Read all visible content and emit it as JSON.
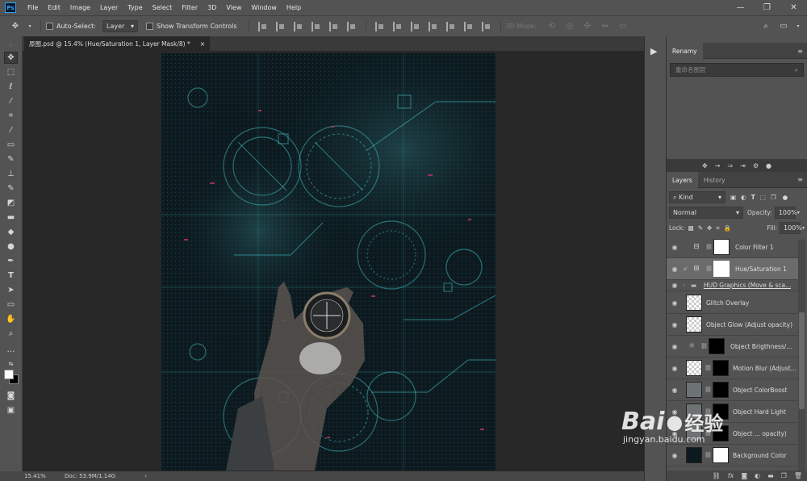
{
  "app": {
    "logo": "Ps"
  },
  "menu": [
    "File",
    "Edit",
    "Image",
    "Layer",
    "Type",
    "Select",
    "Filter",
    "3D",
    "View",
    "Window",
    "Help"
  ],
  "window_controls": [
    "—",
    "❐",
    "✕"
  ],
  "options": {
    "auto_select_label": "Auto-Select:",
    "auto_select_value": "Layer",
    "show_transform_label": "Show Transform Controls",
    "mode_3d_label": "3D Mode:"
  },
  "document_tab": {
    "title": "原图.psd @ 15.4% (Hue/Saturation 1, Layer Mask/8) *",
    "close": "×"
  },
  "status": {
    "zoom": "15.41%",
    "doc": "Doc: 53.9M/1.14G",
    "arrow": "›"
  },
  "renamy_panel": {
    "tab": "Renamy",
    "search_placeholder": "重命名图层"
  },
  "layers_panel": {
    "tabs": [
      "Layers",
      "History"
    ],
    "filter_kind": "Kind",
    "blend_mode": "Normal",
    "opacity_label": "Opacity:",
    "opacity_value": "100%",
    "lock_label": "Lock:",
    "fill_label": "Fill:",
    "fill_value": "100%",
    "layers": [
      {
        "name": "Color Filter 1",
        "type": "adjustment",
        "visible": true,
        "selected": false
      },
      {
        "name": "Hue/Saturation 1",
        "type": "adjustment",
        "visible": true,
        "selected": true
      },
      {
        "name": "HUD Graphics (Move & sca...",
        "type": "group",
        "visible": true,
        "selected": false
      },
      {
        "name": "Glitch Overlay",
        "type": "pixel",
        "visible": true,
        "selected": false
      },
      {
        "name": "Object Glow (Adjust opacity)",
        "type": "pixel",
        "visible": true,
        "selected": false
      },
      {
        "name": "Object Brigthness/...",
        "type": "adjustment",
        "visible": true,
        "selected": false
      },
      {
        "name": "Motion Blur (Adjust...",
        "type": "masked",
        "visible": true,
        "selected": false
      },
      {
        "name": "Object ColorBoost",
        "type": "masked",
        "visible": true,
        "selected": false
      },
      {
        "name": "Object Hard Light",
        "type": "masked",
        "visible": true,
        "selected": false
      },
      {
        "name": "Object ... opacity)",
        "type": "masked",
        "visible": true,
        "selected": false
      },
      {
        "name": "Background Color",
        "type": "fill",
        "visible": true,
        "selected": false
      }
    ]
  },
  "watermark": {
    "brand": "Bai",
    "paw": "du",
    "cn": "经验",
    "url": "jingyan.baidu.com"
  },
  "colors": {
    "accent": "#2fa3f7",
    "panel": "#535353",
    "canvas_bg": "#282828",
    "hud": "#3fb3b8",
    "glitch": "#c0335f"
  }
}
